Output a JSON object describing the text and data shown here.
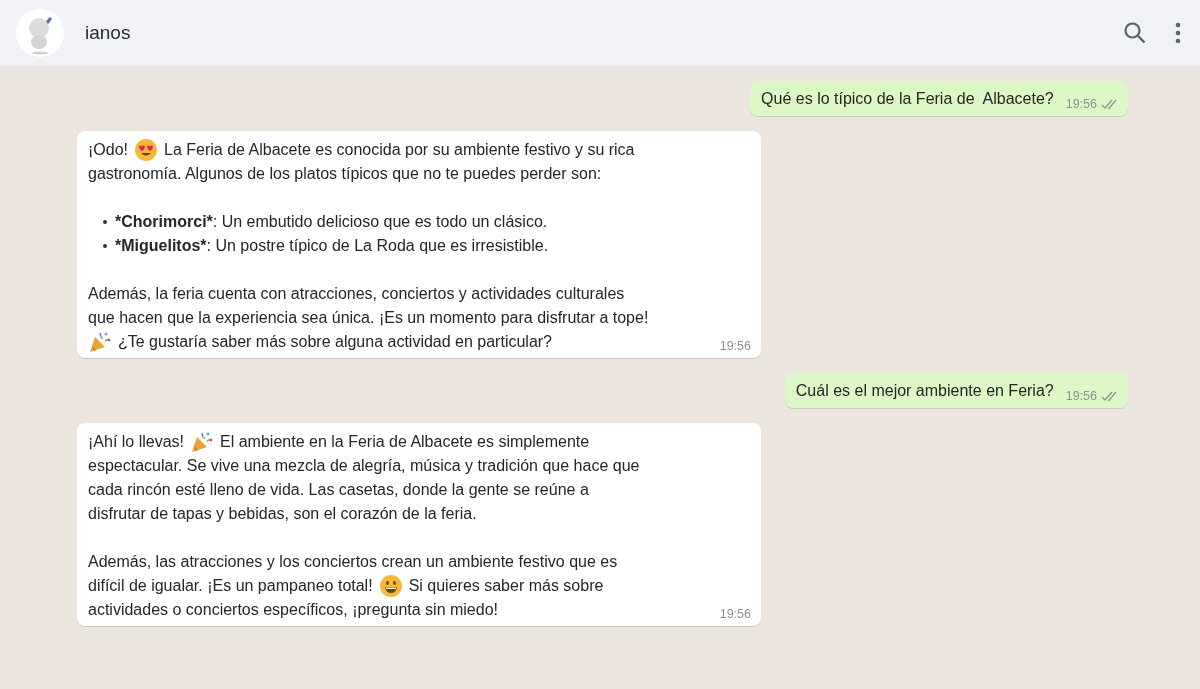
{
  "header": {
    "contact_name": "ianos"
  },
  "messages": [
    {
      "kind": "sent",
      "time": "19:56",
      "parts": [
        {
          "kind": "text",
          "text": "Qué es lo típico de la Feria de  Albacete?"
        }
      ]
    },
    {
      "kind": "received",
      "time": "19:56",
      "blocks": [
        {
          "kind": "paragraph",
          "lines": [
            {
              "parts": [
                {
                  "kind": "text",
                  "text": "¡Odo!"
                },
                {
                  "kind": "hearteyes"
                },
                {
                  "kind": "text",
                  "text": "La Feria de Albacete es conocida por su ambiente festivo y su rica"
                }
              ]
            },
            {
              "parts": [
                {
                  "kind": "text",
                  "text": "gastronomía. Algunos de los platos típicos que no te puedes perder son:"
                }
              ]
            }
          ]
        },
        {
          "kind": "list",
          "items": [
            {
              "term": "*Chorimorci*",
              "text": ": Un embutido delicioso que es todo un clásico."
            },
            {
              "term": "*Miguelitos*",
              "text": ": Un postre típico de La Roda que es irresistible."
            }
          ]
        },
        {
          "kind": "paragraph",
          "lines": [
            {
              "parts": [
                {
                  "kind": "text",
                  "text": "Además, la feria cuenta con atracciones, conciertos y actividades culturales"
                }
              ]
            },
            {
              "parts": [
                {
                  "kind": "text",
                  "text": "que hacen que la experiencia sea única. ¡Es un momento para disfrutar a tope!"
                }
              ]
            },
            {
              "parts": [
                {
                  "kind": "party"
                },
                {
                  "kind": "text",
                  "text": "¿Te gustaría saber más sobre alguna actividad en particular?"
                }
              ]
            }
          ]
        }
      ]
    },
    {
      "kind": "sent",
      "time": "19:56",
      "parts": [
        {
          "kind": "text",
          "text": "Cuál es el mejor ambiente en Feria?"
        }
      ]
    },
    {
      "kind": "received",
      "time": "19:56",
      "blocks": [
        {
          "kind": "paragraph",
          "lines": [
            {
              "parts": [
                {
                  "kind": "text",
                  "text": "¡Ahí lo llevas!"
                },
                {
                  "kind": "party"
                },
                {
                  "kind": "text",
                  "text": "El ambiente en la Feria de Albacete es simplemente"
                }
              ]
            },
            {
              "parts": [
                {
                  "kind": "text",
                  "text": "espectacular. Se vive una mezcla de alegría, música y tradición que hace que"
                }
              ]
            },
            {
              "parts": [
                {
                  "kind": "text",
                  "text": "cada rincón esté lleno de vida. Las casetas, donde la gente se reúne a"
                }
              ]
            },
            {
              "parts": [
                {
                  "kind": "text",
                  "text": "disfrutar de tapas y bebidas, son el corazón de la feria."
                }
              ]
            }
          ]
        },
        {
          "kind": "paragraph",
          "lines": [
            {
              "parts": [
                {
                  "kind": "text",
                  "text": "Además, las atracciones y los conciertos crean un ambiente festivo que es"
                }
              ]
            },
            {
              "parts": [
                {
                  "kind": "text",
                  "text": "difícil de igualar. ¡Es un pampaneo total!"
                },
                {
                  "kind": "grin"
                },
                {
                  "kind": "text",
                  "text": "Si quieres saber más sobre"
                }
              ]
            },
            {
              "parts": [
                {
                  "kind": "text",
                  "text": "actividades o conciertos específicos, ¡pregunta sin miedo!"
                }
              ]
            }
          ]
        }
      ]
    }
  ]
}
